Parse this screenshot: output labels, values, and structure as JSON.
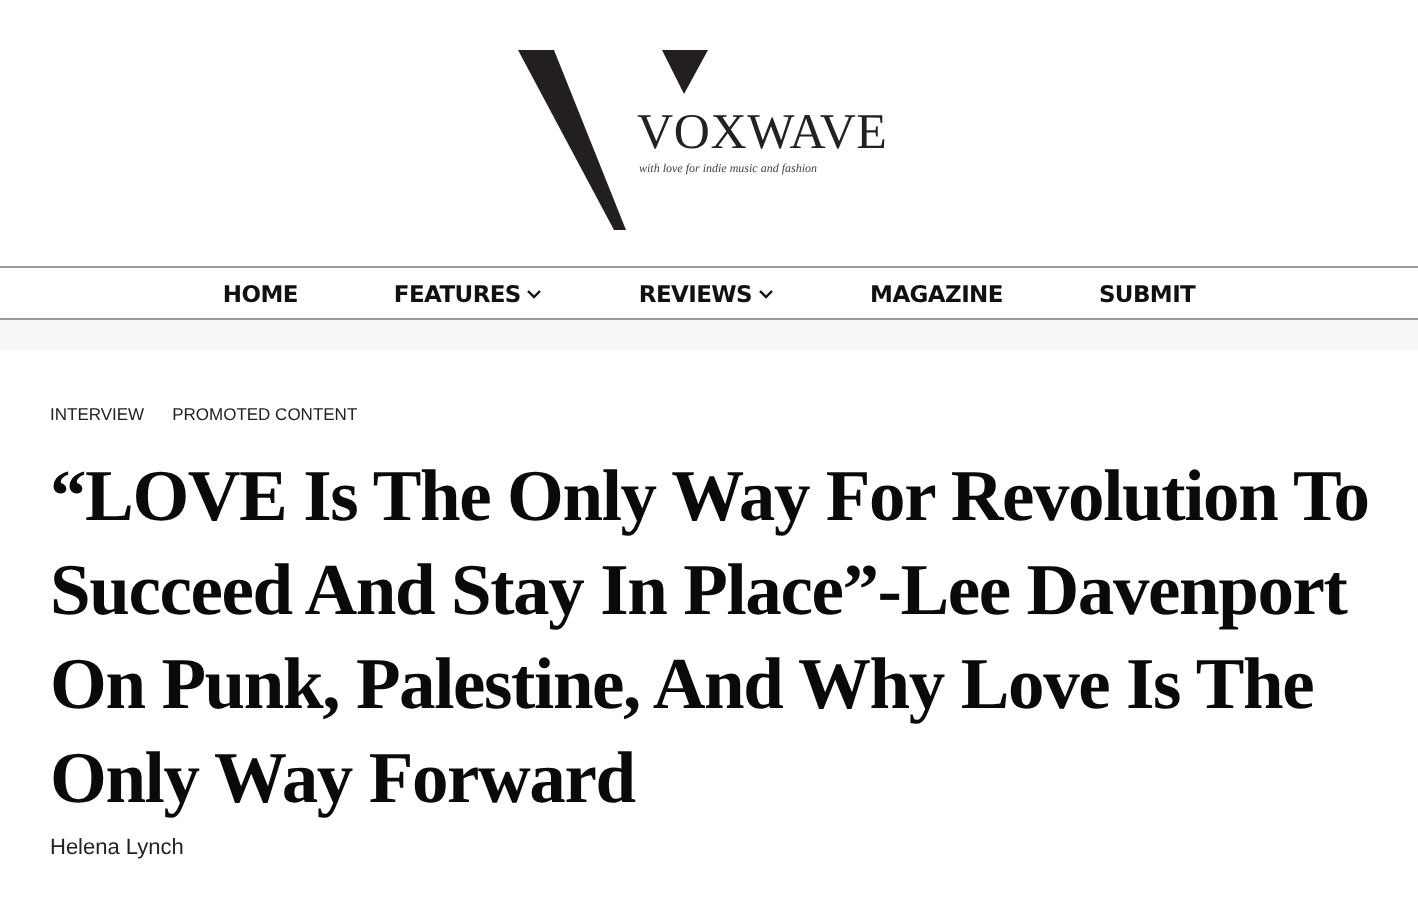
{
  "logo": {
    "name": "VOXWAVE",
    "tagline": "with love for indie music and fashion"
  },
  "nav": [
    {
      "label": "HOME",
      "has_dropdown": false
    },
    {
      "label": "FEATURES",
      "has_dropdown": true
    },
    {
      "label": "REVIEWS",
      "has_dropdown": true
    },
    {
      "label": "MAGAZINE",
      "has_dropdown": false
    },
    {
      "label": "SUBMIT",
      "has_dropdown": false
    }
  ],
  "article": {
    "categories": [
      "INTERVIEW",
      "PROMOTED CONTENT"
    ],
    "title": "“LOVE Is The Only Way For Revolution To Succeed And Stay In Place”-Lee Davenport On Punk, Palestine, And Why Love Is The Only Way Forward",
    "author": "Helena Lynch"
  }
}
